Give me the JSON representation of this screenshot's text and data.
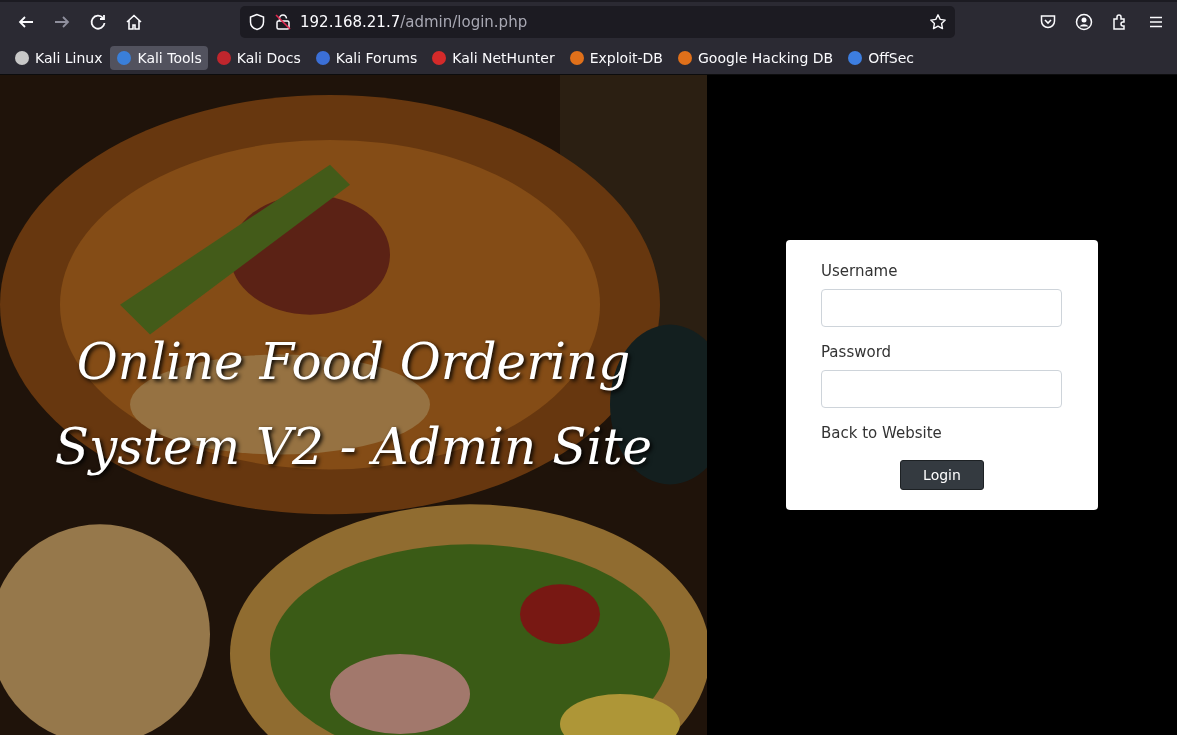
{
  "browser": {
    "nav": [
      {
        "kind": "back",
        "disabled": false
      },
      {
        "kind": "forward",
        "disabled": true
      },
      {
        "kind": "reload",
        "disabled": false
      },
      {
        "kind": "home",
        "disabled": false
      }
    ],
    "address": {
      "host": "192.168.21.7",
      "path": "/admin/login.php"
    },
    "bookmarks": [
      {
        "label": "Kali Linux",
        "color": "#c8c8c8",
        "highlighted": false
      },
      {
        "label": "Kali Tools",
        "color": "#3a7fd9",
        "highlighted": true
      },
      {
        "label": "Kali Docs",
        "color": "#c0262d",
        "highlighted": false
      },
      {
        "label": "Kali Forums",
        "color": "#3b6fd6",
        "highlighted": false
      },
      {
        "label": "Kali NetHunter",
        "color": "#d42a2a",
        "highlighted": false
      },
      {
        "label": "Exploit-DB",
        "color": "#e0701a",
        "highlighted": false
      },
      {
        "label": "Google Hacking DB",
        "color": "#e0701a",
        "highlighted": false
      },
      {
        "label": "OffSec",
        "color": "#3d7ee0",
        "highlighted": false
      }
    ]
  },
  "hero": {
    "title": "Online Food Ordering System V2 - Admin Site"
  },
  "login": {
    "fields": [
      {
        "label": "Username"
      },
      {
        "label": "Password"
      }
    ],
    "back_link": "Back to Website",
    "button": "Login"
  }
}
